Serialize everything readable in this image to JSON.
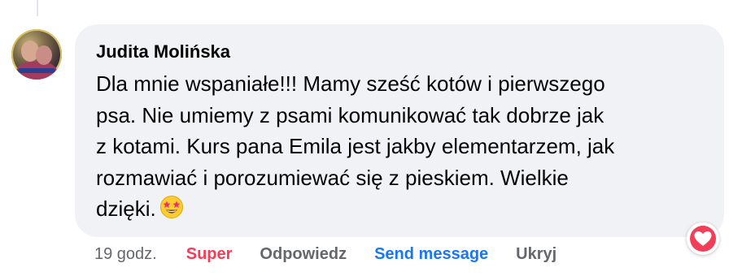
{
  "comment": {
    "author": "Judita Molińska",
    "text": "Dla mnie wspaniałe!!! Mamy sześć kotów i pierwszego\npsa. Nie umiemy z psami komunikować tak dobrze jak\nz kotami. Kurs pana Emila jest jakby elementarzem, jak\nrozmawiać i porozumiewać się z pieskiem. Wielkie\ndzięki.",
    "emoji": "star-struck-emoji"
  },
  "actions": {
    "time": "19 godz.",
    "super": "Super",
    "reply": "Odpowiedz",
    "send_message": "Send message",
    "hide": "Ukryj"
  },
  "reaction": {
    "icon": "heart-icon",
    "color": "#f33e58"
  },
  "colors": {
    "bubble": "#f0f2f5",
    "super": "#f33e58",
    "link": "#1877f2",
    "muted": "#65676b"
  }
}
